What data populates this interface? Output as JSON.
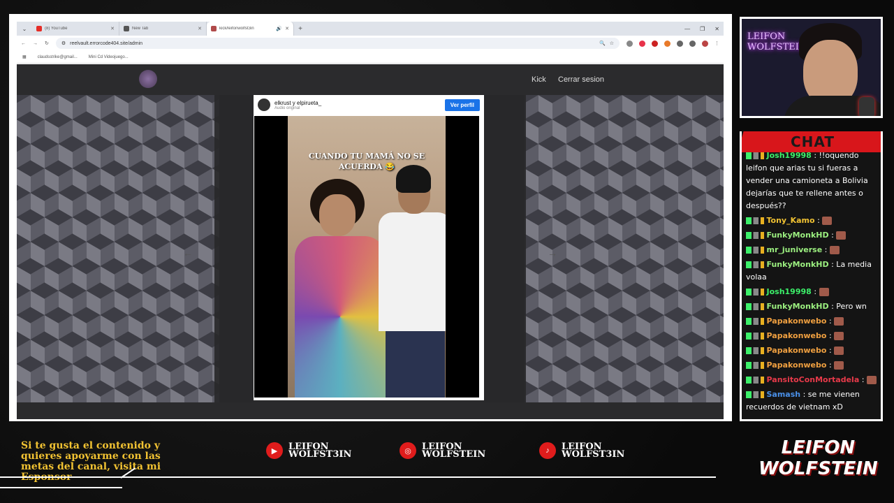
{
  "browser": {
    "tabs": [
      {
        "title": "(8) YouTube",
        "favicon_color": "#e52d27"
      },
      {
        "title": "New Tab",
        "favicon_color": "#555555"
      },
      {
        "title": "kick/leifonwolfst3in",
        "favicon_color": "#b04a4a"
      }
    ],
    "new_tab_symbol": "+",
    "url": "reelvault.errorcode404.site/admin",
    "bookmarks": [
      "claudsstrike@gmail...",
      "Mini Cd Videojuego..."
    ]
  },
  "site": {
    "nav": {
      "kick": "Kick",
      "logout": "Cerrar sesion"
    },
    "post": {
      "user": "elkrust y elpirueta_",
      "audio": "Audio original",
      "profile_button": "Ver perfil",
      "caption": "CUANDO TU MAMÁ NO SE ACUERDA 😂"
    }
  },
  "webcam": {
    "neon_text_1": "LEIFON",
    "neon_text_2": "WOLFSTEIN"
  },
  "chat": {
    "title": "CHAT",
    "messages": [
      {
        "user": "Josh19998",
        "text": ": !!oquendo leifon que arias tu si fueras a vender una camioneta a Bolivia dejarías que te rellene antes o después??",
        "color": "#3cf06a"
      },
      {
        "user": "Tony_Kamo",
        "text": ":",
        "color": "#f1c232"
      },
      {
        "user": "FunkyMonkHD",
        "text": ":",
        "color": "#9cf080"
      },
      {
        "user": "mr_juniverse",
        "text": ":",
        "color": "#9cf080"
      },
      {
        "user": "FunkyMonkHD",
        "text": ": La media volaa",
        "color": "#9cf080"
      },
      {
        "user": "Josh19998",
        "text": ":",
        "color": "#3cf06a"
      },
      {
        "user": "FunkyMonkHD",
        "text": ": Pero wn",
        "color": "#9cf080"
      },
      {
        "user": "Papakonwebo",
        "text": ":",
        "color": "#f0a040"
      },
      {
        "user": "Papakonwebo",
        "text": ":",
        "color": "#f0a040"
      },
      {
        "user": "Papakonwebo",
        "text": ":",
        "color": "#f0a040"
      },
      {
        "user": "Papakonwebo",
        "text": ":",
        "color": "#f0a040"
      },
      {
        "user": "PansitoConMortadela",
        "text": ":",
        "color": "#e83a4a"
      },
      {
        "user": "Samash",
        "text": ": se me vienen recuerdos de vietnam xD",
        "color": "#4a90e8"
      }
    ]
  },
  "banner": {
    "promo": "Si te gusta el contenido y quieres apoyarme con las metas del canal, visita mi Esponsor",
    "social": [
      {
        "icon": "youtube-icon",
        "line1": "LEIFON",
        "line2": "WOLFST3IN"
      },
      {
        "icon": "instagram-icon",
        "line1": "LEIFON",
        "line2": "WOLFSTEIN"
      },
      {
        "icon": "tiktok-icon",
        "line1": "LEIFON",
        "line2": "WOLFST3IN"
      }
    ],
    "logo_line1": "LEIFON",
    "logo_line2": "WOLFSTEIN"
  }
}
